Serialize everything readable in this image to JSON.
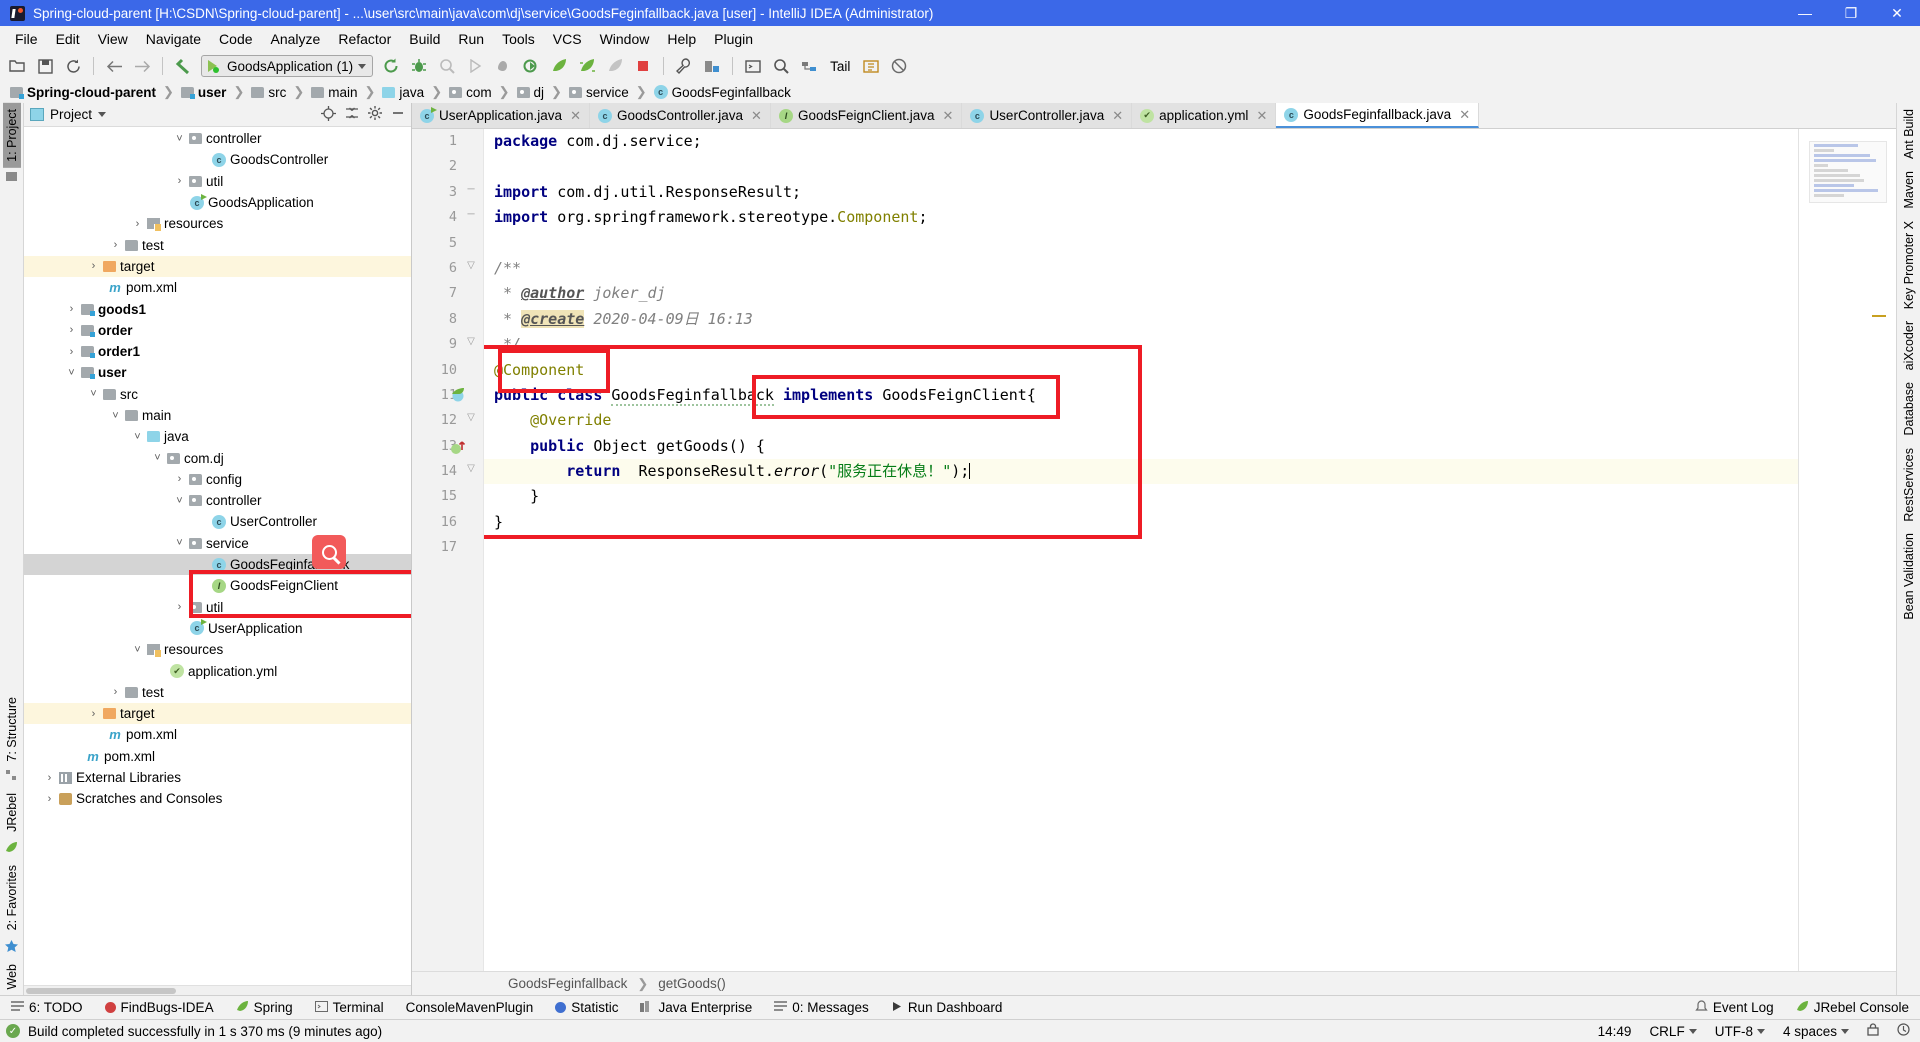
{
  "window": {
    "title": "Spring-cloud-parent [H:\\CSDN\\Spring-cloud-parent] - ...\\user\\src\\main\\java\\com\\dj\\service\\GoodsFeginfallback.java [user] - IntelliJ IDEA (Administrator)",
    "minimize": "—",
    "maximize": "❐",
    "close": "✕",
    "accent": "#3b68e8"
  },
  "menubar": [
    {
      "label": "File"
    },
    {
      "label": "Edit"
    },
    {
      "label": "View"
    },
    {
      "label": "Navigate"
    },
    {
      "label": "Code"
    },
    {
      "label": "Analyze"
    },
    {
      "label": "Refactor"
    },
    {
      "label": "Build"
    },
    {
      "label": "Run"
    },
    {
      "label": "Tools"
    },
    {
      "label": "VCS"
    },
    {
      "label": "Window"
    },
    {
      "label": "Help"
    },
    {
      "label": "Plugin"
    }
  ],
  "toolbar": {
    "run_config": "GoodsApplication (1)",
    "tail_label": "Tail",
    "icons": [
      "open-folder-icon",
      "save-all-icon",
      "sync-icon",
      "back-arrow-icon",
      "forward-arrow-icon",
      "undo-icon",
      "rerun-icon",
      "debug-icon",
      "coverage-icon",
      "run-icon",
      "stop-icon",
      "attach-icon",
      "jrebel-run-icon",
      "jrebel-debug-icon",
      "jrebel-disabled-icon",
      "stop-red-icon",
      "settings-wrench-icon",
      "project-structure-icon",
      "terminal-icon",
      "search-everywhere-icon",
      "git-update-icon",
      "tail-icon",
      "ide-help-icon",
      "block-icon"
    ]
  },
  "breadcrumb": [
    {
      "label": "Spring-cloud-parent",
      "icon": "module-folder-icon",
      "bold": true
    },
    {
      "label": "user",
      "icon": "module-folder-icon",
      "bold": true
    },
    {
      "label": "src",
      "icon": "folder-icon",
      "bold": false
    },
    {
      "label": "main",
      "icon": "folder-icon",
      "bold": false
    },
    {
      "label": "java",
      "icon": "source-folder-icon",
      "bold": false
    },
    {
      "label": "com",
      "icon": "package-icon",
      "bold": false
    },
    {
      "label": "dj",
      "icon": "package-icon",
      "bold": false
    },
    {
      "label": "service",
      "icon": "package-icon",
      "bold": false
    },
    {
      "label": "GoodsFeginfallback",
      "icon": "class-icon",
      "bold": false
    }
  ],
  "project_panel": {
    "header_title": "Project",
    "header_icons": [
      "locate-icon",
      "collapse-all-icon",
      "settings-gear-icon",
      "hide-icon"
    ],
    "tree": [
      {
        "label": "controller",
        "icon": "package-icon",
        "indent": 7,
        "arrow": "v",
        "bg": "none",
        "bold": false
      },
      {
        "label": "GoodsController",
        "icon": "class-icon",
        "indent": 9,
        "arrow": "",
        "bg": "none",
        "bold": false
      },
      {
        "label": "util",
        "icon": "package-icon",
        "indent": 7,
        "arrow": ">",
        "bg": "none",
        "bold": false
      },
      {
        "label": "GoodsApplication",
        "icon": "spring-class-icon",
        "indent": 8,
        "arrow": "",
        "bg": "none",
        "bold": false
      },
      {
        "label": "resources",
        "icon": "resources-folder-icon",
        "indent": 5,
        "arrow": ">",
        "bg": "none",
        "bold": false
      },
      {
        "label": "test",
        "icon": "folder-icon",
        "indent": 4,
        "arrow": ">",
        "bg": "none",
        "bold": false
      },
      {
        "label": "target",
        "icon": "excluded-folder-icon",
        "indent": 3,
        "arrow": ">",
        "bg": "warn",
        "bold": false
      },
      {
        "label": "pom.xml",
        "icon": "maven-icon",
        "indent": 4,
        "arrow": "",
        "bg": "none",
        "bold": false
      },
      {
        "label": "goods1",
        "icon": "module-folder-icon",
        "indent": 2,
        "arrow": ">",
        "bg": "none",
        "bold": true
      },
      {
        "label": "order",
        "icon": "module-folder-icon",
        "indent": 2,
        "arrow": ">",
        "bg": "none",
        "bold": true
      },
      {
        "label": "order1",
        "icon": "module-folder-icon",
        "indent": 2,
        "arrow": ">",
        "bg": "none",
        "bold": true
      },
      {
        "label": "user",
        "icon": "module-folder-icon",
        "indent": 2,
        "arrow": "v",
        "bg": "none",
        "bold": true
      },
      {
        "label": "src",
        "icon": "folder-icon",
        "indent": 3,
        "arrow": "v",
        "bg": "none",
        "bold": false
      },
      {
        "label": "main",
        "icon": "folder-icon",
        "indent": 4,
        "arrow": "v",
        "bg": "none",
        "bold": false
      },
      {
        "label": "java",
        "icon": "source-folder-icon",
        "indent": 5,
        "arrow": "v",
        "bg": "none",
        "bold": false
      },
      {
        "label": "com.dj",
        "icon": "package-icon",
        "indent": 6,
        "arrow": "v",
        "bg": "none",
        "bold": false
      },
      {
        "label": "config",
        "icon": "package-icon",
        "indent": 7,
        "arrow": ">",
        "bg": "none",
        "bold": false
      },
      {
        "label": "controller",
        "icon": "package-icon",
        "indent": 7,
        "arrow": "v",
        "bg": "none",
        "bold": false
      },
      {
        "label": "UserController",
        "icon": "class-icon",
        "indent": 9,
        "arrow": "",
        "bg": "none",
        "bold": false
      },
      {
        "label": "service",
        "icon": "package-icon",
        "indent": 7,
        "arrow": "v",
        "bg": "none",
        "bold": false
      },
      {
        "label": "GoodsFeginfallback",
        "icon": "class-icon",
        "indent": 9,
        "arrow": "",
        "bg": "sel",
        "bold": false
      },
      {
        "label": "GoodsFeignClient",
        "icon": "interface-icon",
        "indent": 9,
        "arrow": "",
        "bg": "none",
        "bold": false
      },
      {
        "label": "util",
        "icon": "package-icon",
        "indent": 7,
        "arrow": ">",
        "bg": "none",
        "bold": false
      },
      {
        "label": "UserApplication",
        "icon": "spring-class-icon",
        "indent": 8,
        "arrow": "",
        "bg": "none",
        "bold": false
      },
      {
        "label": "resources",
        "icon": "resources-folder-icon",
        "indent": 5,
        "arrow": "v",
        "bg": "none",
        "bold": false
      },
      {
        "label": "application.yml",
        "icon": "yml-icon",
        "indent": 7,
        "arrow": "",
        "bg": "none",
        "bold": false
      },
      {
        "label": "test",
        "icon": "folder-icon",
        "indent": 4,
        "arrow": ">",
        "bg": "none",
        "bold": false
      },
      {
        "label": "target",
        "icon": "excluded-folder-icon",
        "indent": 3,
        "arrow": ">",
        "bg": "warn",
        "bold": false
      },
      {
        "label": "pom.xml",
        "icon": "maven-icon",
        "indent": 4,
        "arrow": "",
        "bg": "none",
        "bold": false
      },
      {
        "label": "pom.xml",
        "icon": "maven-icon",
        "indent": 3,
        "arrow": "",
        "bg": "none",
        "bold": false
      },
      {
        "label": "External Libraries",
        "icon": "libraries-icon",
        "indent": 1,
        "arrow": ">",
        "bg": "none",
        "bold": false
      },
      {
        "label": "Scratches and Consoles",
        "icon": "scratches-icon",
        "indent": 1,
        "arrow": ">",
        "bg": "none",
        "bold": false
      }
    ]
  },
  "left_strip": {
    "top": [
      {
        "label": "1: Project",
        "selected": true
      }
    ],
    "bottom": [
      {
        "label": "7: Structure",
        "selected": false
      },
      {
        "label": "JRebel",
        "selected": false
      },
      {
        "label": "2: Favorites",
        "selected": false
      },
      {
        "label": "Web",
        "selected": false
      }
    ]
  },
  "right_strip": [
    {
      "label": "Ant Build"
    },
    {
      "label": "Maven"
    },
    {
      "label": "Key Promoter X"
    },
    {
      "label": "aiXcoder"
    },
    {
      "label": "Database"
    },
    {
      "label": "RestServices"
    },
    {
      "label": "Bean Validation"
    }
  ],
  "editor": {
    "tabs": [
      {
        "label": "UserApplication.java",
        "icon": "spring-class-icon",
        "active": false
      },
      {
        "label": "GoodsController.java",
        "icon": "class-icon",
        "active": false
      },
      {
        "label": "GoodsFeignClient.java",
        "icon": "interface-icon",
        "active": false
      },
      {
        "label": "UserController.java",
        "icon": "class-icon",
        "active": false
      },
      {
        "label": "application.yml",
        "icon": "yml-icon",
        "active": false
      },
      {
        "label": "GoodsFeginfallback.java",
        "icon": "class-icon",
        "active": true
      }
    ],
    "lines": [
      {
        "n": 1,
        "segments": [
          {
            "t": "kw",
            "v": "package"
          },
          {
            "t": "plain",
            "v": " com.dj.service;"
          }
        ],
        "indent": 0
      },
      {
        "n": 2,
        "segments": [],
        "indent": 0
      },
      {
        "n": 3,
        "segments": [
          {
            "t": "kw",
            "v": "import"
          },
          {
            "t": "plain",
            "v": " com.dj.util.ResponseResult;"
          }
        ],
        "indent": 0
      },
      {
        "n": 4,
        "segments": [
          {
            "t": "kw",
            "v": "import"
          },
          {
            "t": "plain",
            "v": " org.springframework.stereotype."
          },
          {
            "t": "ann",
            "v": "Component"
          },
          {
            "t": "plain",
            "v": ";"
          }
        ],
        "indent": 0
      },
      {
        "n": 5,
        "segments": [],
        "indent": 0
      },
      {
        "n": 6,
        "segments": [
          {
            "t": "cmt",
            "v": "/**"
          }
        ],
        "indent": 0
      },
      {
        "n": 7,
        "segments": [
          {
            "t": "cmt",
            "v": " * "
          },
          {
            "t": "doctag",
            "v": "@author"
          },
          {
            "t": "cmt",
            "v": " joker_dj"
          }
        ],
        "indent": 0
      },
      {
        "n": 8,
        "segments": [
          {
            "t": "cmt",
            "v": " * "
          },
          {
            "t": "doctaghl",
            "v": "@create"
          },
          {
            "t": "cmt",
            "v": " 2020-04-09日 16:13"
          }
        ],
        "indent": 0
      },
      {
        "n": 9,
        "segments": [
          {
            "t": "cmt",
            "v": " */"
          }
        ],
        "indent": 0
      },
      {
        "n": 10,
        "segments": [
          {
            "t": "ann",
            "v": "@Component"
          }
        ],
        "indent": 0
      },
      {
        "n": 11,
        "segments": [
          {
            "t": "kw",
            "v": "public class"
          },
          {
            "t": "plain",
            "v": " GoodsFeginfallback "
          },
          {
            "t": "kw",
            "v": "implements"
          },
          {
            "t": "plain",
            "v": " GoodsFeignClient{"
          }
        ],
        "indent": 0
      },
      {
        "n": 12,
        "segments": [
          {
            "t": "ann",
            "v": "    @Override"
          }
        ],
        "indent": 0
      },
      {
        "n": 13,
        "segments": [
          {
            "t": "kw",
            "v": "    public"
          },
          {
            "t": "plain",
            "v": " Object getGoods() {"
          }
        ],
        "indent": 0
      },
      {
        "n": 14,
        "segments": [
          {
            "t": "kw",
            "v": "        return"
          },
          {
            "t": "plain",
            "v": "  ResponseResult."
          },
          {
            "t": "cmtital",
            "v": "error"
          },
          {
            "t": "plain",
            "v": "("
          },
          {
            "t": "str",
            "v": "\"服务正在休息！\""
          },
          {
            "t": "plain",
            "v": ");"
          }
        ],
        "indent": 0,
        "current": true
      },
      {
        "n": 15,
        "segments": [
          {
            "t": "plain",
            "v": "    }"
          }
        ],
        "indent": 0
      },
      {
        "n": 16,
        "segments": [
          {
            "t": "plain",
            "v": "}"
          }
        ],
        "indent": 0
      },
      {
        "n": 17,
        "segments": [],
        "indent": 0
      }
    ],
    "bottom_breadcrumb": [
      {
        "label": "GoodsFeginfallback"
      },
      {
        "label": "getGoods()"
      }
    ]
  },
  "bottom_toolwindows": [
    {
      "label": "6: TODO",
      "icon": "todo-icon"
    },
    {
      "label": "FindBugs-IDEA",
      "icon": "findbugs-icon"
    },
    {
      "label": "Spring",
      "icon": "spring-leaf-icon"
    },
    {
      "label": "Terminal",
      "icon": "terminal-icon"
    },
    {
      "label": "ConsoleMavenPlugin",
      "icon": "maven-console-icon"
    },
    {
      "label": "Statistic",
      "icon": "statistic-icon"
    },
    {
      "label": "Java Enterprise",
      "icon": "java-enterprise-icon"
    },
    {
      "label": "0: Messages",
      "icon": "messages-icon"
    },
    {
      "label": "Run Dashboard",
      "icon": "run-dashboard-icon"
    }
  ],
  "bottom_toolwindows_right": [
    {
      "label": "Event Log",
      "icon": "event-log-icon"
    },
    {
      "label": "JRebel Console",
      "icon": "jrebel-icon"
    }
  ],
  "statusbar": {
    "message": "Build completed successfully in 1 s 370 ms (9 minutes ago)",
    "time": "14:49",
    "line_sep": "CRLF",
    "encoding": "UTF-8",
    "indent": "4 spaces",
    "lock_icon": "lock-icon",
    "event_icon": "event-icon"
  },
  "annotations": {
    "box_color": "#ee1c25",
    "boxes": [
      {
        "name": "component-annotation-box"
      },
      {
        "name": "implements-clause-box"
      },
      {
        "name": "class-body-box"
      },
      {
        "name": "tree-service-files-box"
      }
    ],
    "search_badge": "search-magnifier-badge"
  }
}
